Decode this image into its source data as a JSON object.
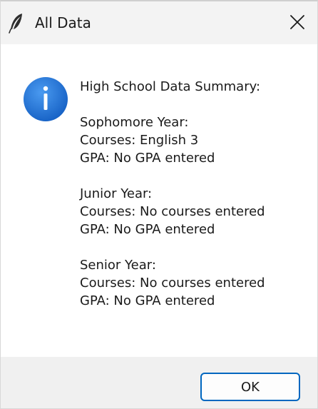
{
  "window": {
    "title": "All Data",
    "title_icon": "feather-icon",
    "close_icon": "close-icon"
  },
  "message": {
    "icon": "info-icon",
    "heading": "High School Data Summary:",
    "sections": [
      {
        "year": "Sophomore Year:",
        "courses": "Courses: English 3",
        "gpa": "GPA: No GPA entered"
      },
      {
        "year": "Junior Year:",
        "courses": "Courses: No courses entered",
        "gpa": "GPA: No GPA entered"
      },
      {
        "year": "Senior Year:",
        "courses": "Courses: No courses entered",
        "gpa": "GPA: No GPA entered"
      }
    ]
  },
  "footer": {
    "ok_label": "OK"
  },
  "colors": {
    "info_blue": "#1f6fd1",
    "button_border": "#0067c0"
  }
}
